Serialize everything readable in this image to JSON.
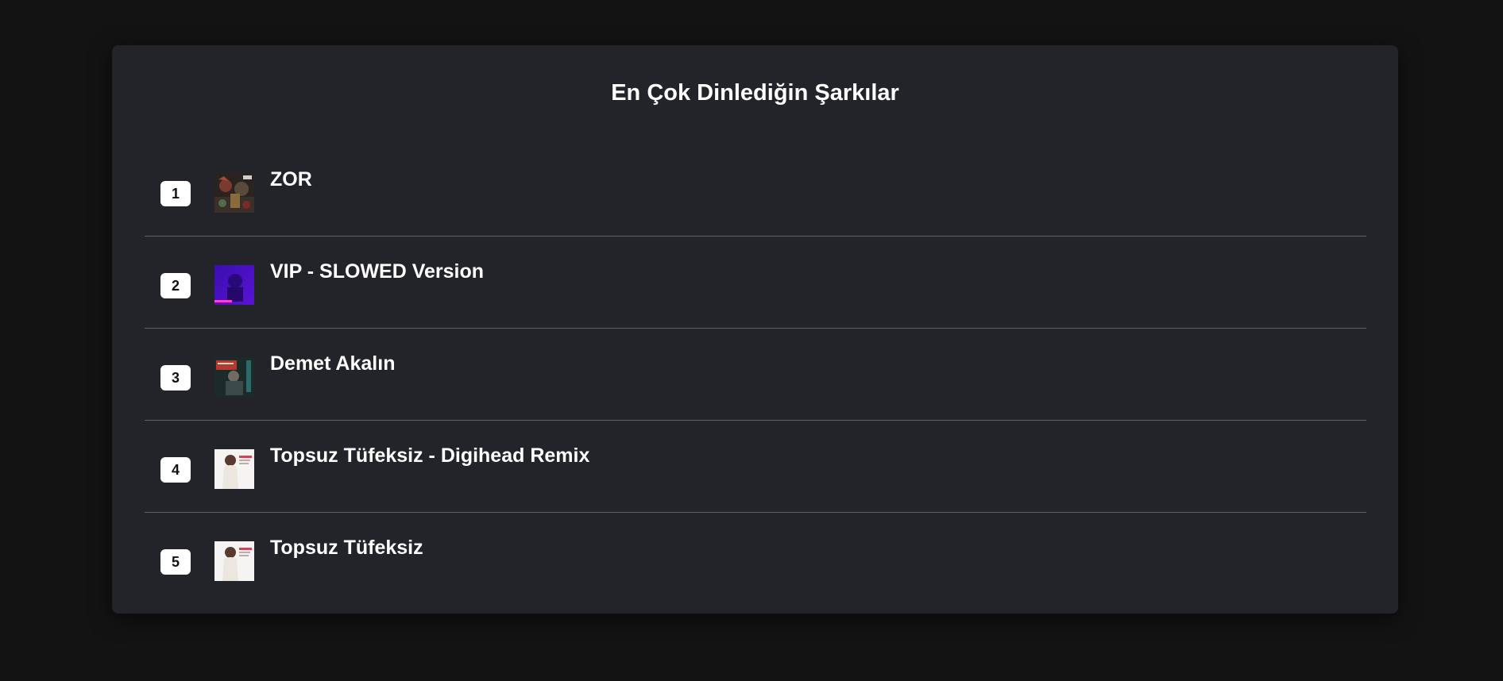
{
  "page": {
    "title": "En Çok Dinlediğin Şarkılar"
  },
  "tracks": [
    {
      "rank": "1",
      "name": "ZOR",
      "cover_icon": "album-cover-zor-icon"
    },
    {
      "rank": "2",
      "name": "VIP - SLOWED Version",
      "cover_icon": "album-cover-vip-icon"
    },
    {
      "rank": "3",
      "name": "Demet Akalın",
      "cover_icon": "album-cover-demet-akalin-icon"
    },
    {
      "rank": "4",
      "name": "Topsuz Tüfeksiz - Digihead Remix",
      "cover_icon": "album-cover-topsuz-tufeksiz-remix-icon"
    },
    {
      "rank": "5",
      "name": "Topsuz Tüfeksiz",
      "cover_icon": "album-cover-topsuz-tufeksiz-icon"
    }
  ],
  "colors": {
    "background": "#131314",
    "card": "#222429",
    "divider": "#5d6066",
    "text": "#ffffff",
    "badge": "#ffffff"
  }
}
